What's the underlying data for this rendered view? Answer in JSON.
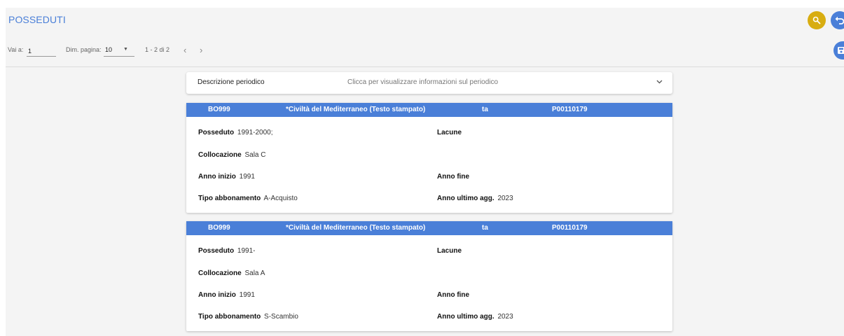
{
  "header": {
    "title": "POSSEDUTI"
  },
  "pager": {
    "goto_label": "Vai a:",
    "goto_value": "1",
    "page_size_label": "Dim. pagina:",
    "page_size_value": "10",
    "range": "1 - 2 di 2",
    "prev": "‹",
    "next": "›"
  },
  "description": {
    "title": "Descrizione periodico",
    "hint": "Clicca per visualizzare informazioni sul periodico"
  },
  "labels": {
    "posseduto": "Posseduto",
    "lacune": "Lacune",
    "collocazione": "Collocazione",
    "anno_inizio": "Anno inizio",
    "anno_fine": "Anno fine",
    "tipo_abbonamento": "Tipo abbonamento",
    "anno_ultimo_agg": "Anno ultimo agg."
  },
  "cards": [
    {
      "code": "BO999",
      "title": "*Civiltà del Mediterraneo (Testo stampato)",
      "type": "ta",
      "id": "P00110179",
      "posseduto": "1991-2000;",
      "lacune": "",
      "collocazione": "Sala C",
      "anno_inizio": "1991",
      "anno_fine": "",
      "tipo_abbonamento": "A-Acquisto",
      "anno_ultimo_agg": "2023"
    },
    {
      "code": "BO999",
      "title": "*Civiltà del Mediterraneo (Testo stampato)",
      "type": "ta",
      "id": "P00110179",
      "posseduto": "1991-",
      "lacune": "",
      "collocazione": "Sala A",
      "anno_inizio": "1991",
      "anno_fine": "",
      "tipo_abbonamento": "S-Scambio",
      "anno_ultimo_agg": "2023"
    }
  ],
  "icons": {
    "search": "search-icon",
    "back": "undo-icon",
    "save": "save-icon",
    "expand": "chevron-down-icon"
  },
  "colors": {
    "accent": "#4a7fd8",
    "search_button": "#d8ad11",
    "background": "#f4f4f4"
  }
}
